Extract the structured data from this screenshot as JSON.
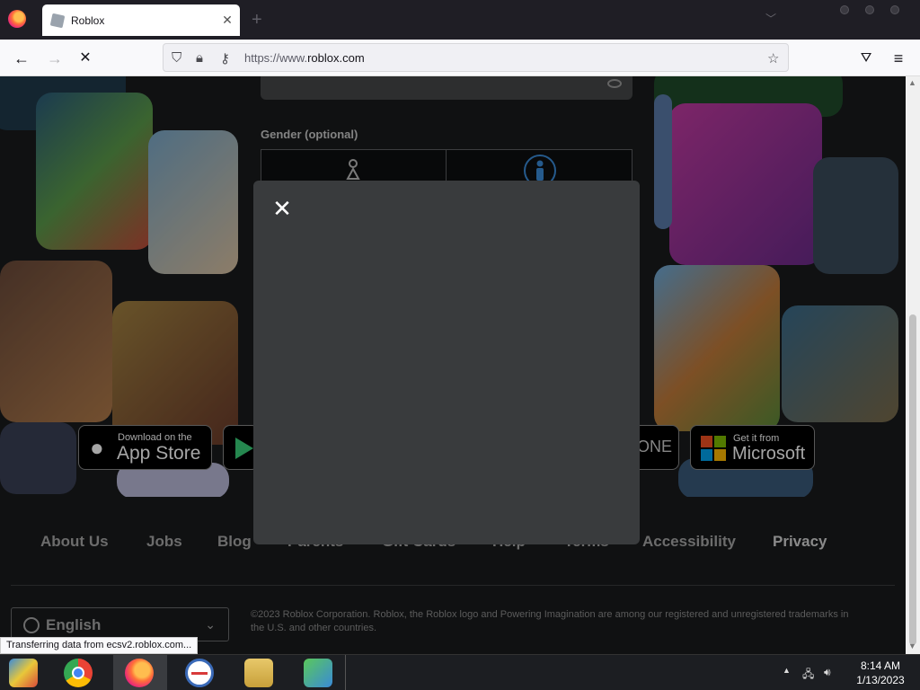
{
  "browser": {
    "tab_title": "Roblox",
    "tab_close": "✕",
    "new_tab": "+",
    "url_prefix": "https://www.",
    "url_domain": "roblox.com",
    "back": "←",
    "forward": "→",
    "stop": "✕",
    "status": "Transferring data from ecsv2.roblox.com..."
  },
  "form": {
    "gender_label": "Gender (optional)"
  },
  "badges": {
    "appstore_small": "Download on the",
    "appstore_big": "App Store",
    "xbox_text": "ONE",
    "microsoft_small": "Get it from",
    "microsoft_big": "Microsoft"
  },
  "footer": {
    "links": [
      "About Us",
      "Jobs",
      "Blog",
      "Parents",
      "Gift Cards",
      "Help",
      "Terms",
      "Accessibility",
      "Privacy"
    ],
    "language": "English",
    "copyright": "©2023 Roblox Corporation. Roblox, the Roblox logo and Powering Imagination are among our registered and unregistered trademarks in the U.S. and other countries."
  },
  "modal": {
    "close": "✕"
  },
  "taskbar": {
    "time": "8:14 AM",
    "date": "1/13/2023"
  },
  "colors": {
    "page_bg": "#191b1d",
    "modal_bg": "#393b3d",
    "taskbar_bg": "#1c1e22"
  }
}
